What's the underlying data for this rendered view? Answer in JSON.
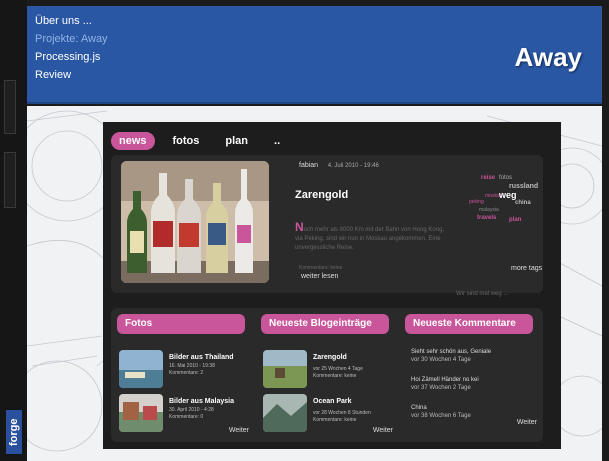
{
  "nav": {
    "items": [
      "Über uns ...",
      "Projekte: Away",
      "Processing.js",
      "Review"
    ],
    "active_index": 1
  },
  "page_title": "Away",
  "brand_logo": "forge",
  "site": {
    "tabs": [
      "news",
      "fotos",
      "plan",
      ".."
    ],
    "active_tab": 0,
    "post": {
      "author": "fabian",
      "date": "4. Juli 2010 - 19:46",
      "title": "Zarengold",
      "dropcap": "N",
      "excerpt": "och mehr als 8000 Km mit der Bahn von Hong Kong, via Peking, sind wir nun in Moskau angekommen. Eine unvergessliche Reise.",
      "comments": "Kommentare: keine",
      "read_more": "weiter lesen"
    },
    "tags": [
      {
        "text": "reise",
        "color": "#c9559a"
      },
      {
        "text": "fotos",
        "color": "#aaaaaa"
      },
      {
        "text": "russland",
        "color": "#bbbbbb"
      },
      {
        "text": "moskau",
        "color": "#c9559a"
      },
      {
        "text": "weg",
        "color": "#ffffff"
      },
      {
        "text": "peking",
        "color": "#c9559a"
      },
      {
        "text": "china",
        "color": "#bbbbbb"
      },
      {
        "text": "malaysia",
        "color": "#888888"
      },
      {
        "text": "travels",
        "color": "#c9559a"
      },
      {
        "text": "plan",
        "color": "#c9559a"
      }
    ],
    "more_tags": "more tags",
    "tagline": "Wir sind mal weg ...",
    "fotos": {
      "heading": "Fotos",
      "items": [
        {
          "title": "Bilder aus Thailand",
          "date": "16. Mai 2010 - 19:38",
          "comments": "Kommentare: 2"
        },
        {
          "title": "Bilder aus Malaysia",
          "date": "30. April 2010 - 4:28",
          "comments": "Kommentare: 0"
        }
      ],
      "more": "Weiter"
    },
    "blog": {
      "heading": "Neueste Blogeinträge",
      "items": [
        {
          "title": "Zarengold",
          "ago": "vor 25 Wochen 4 Tage",
          "comments": "Kommentare: keine"
        },
        {
          "title": "Ocean Park",
          "ago": "vor 28 Wochen 8 Stunden",
          "comments": "Kommentare: keine"
        }
      ],
      "more": "Weiter"
    },
    "comments": {
      "heading": "Neueste Kommentare",
      "items": [
        {
          "text": "Sieht sehr schön aus, Geniale",
          "ago": "vor 30 Wochen 4 Tage"
        },
        {
          "text": "Hoi Zämell Händer no kei",
          "ago": "vor 37 Wochen 2 Tage"
        },
        {
          "text": "China",
          "ago": "vor 38 Wochen 6 Tage"
        }
      ],
      "more": "Weiter"
    }
  },
  "colors": {
    "header_blue": "#2a57a3",
    "accent_pink": "#c9559a",
    "site_bg": "#1d1d1d",
    "panel_bg": "#2a2a2a"
  }
}
